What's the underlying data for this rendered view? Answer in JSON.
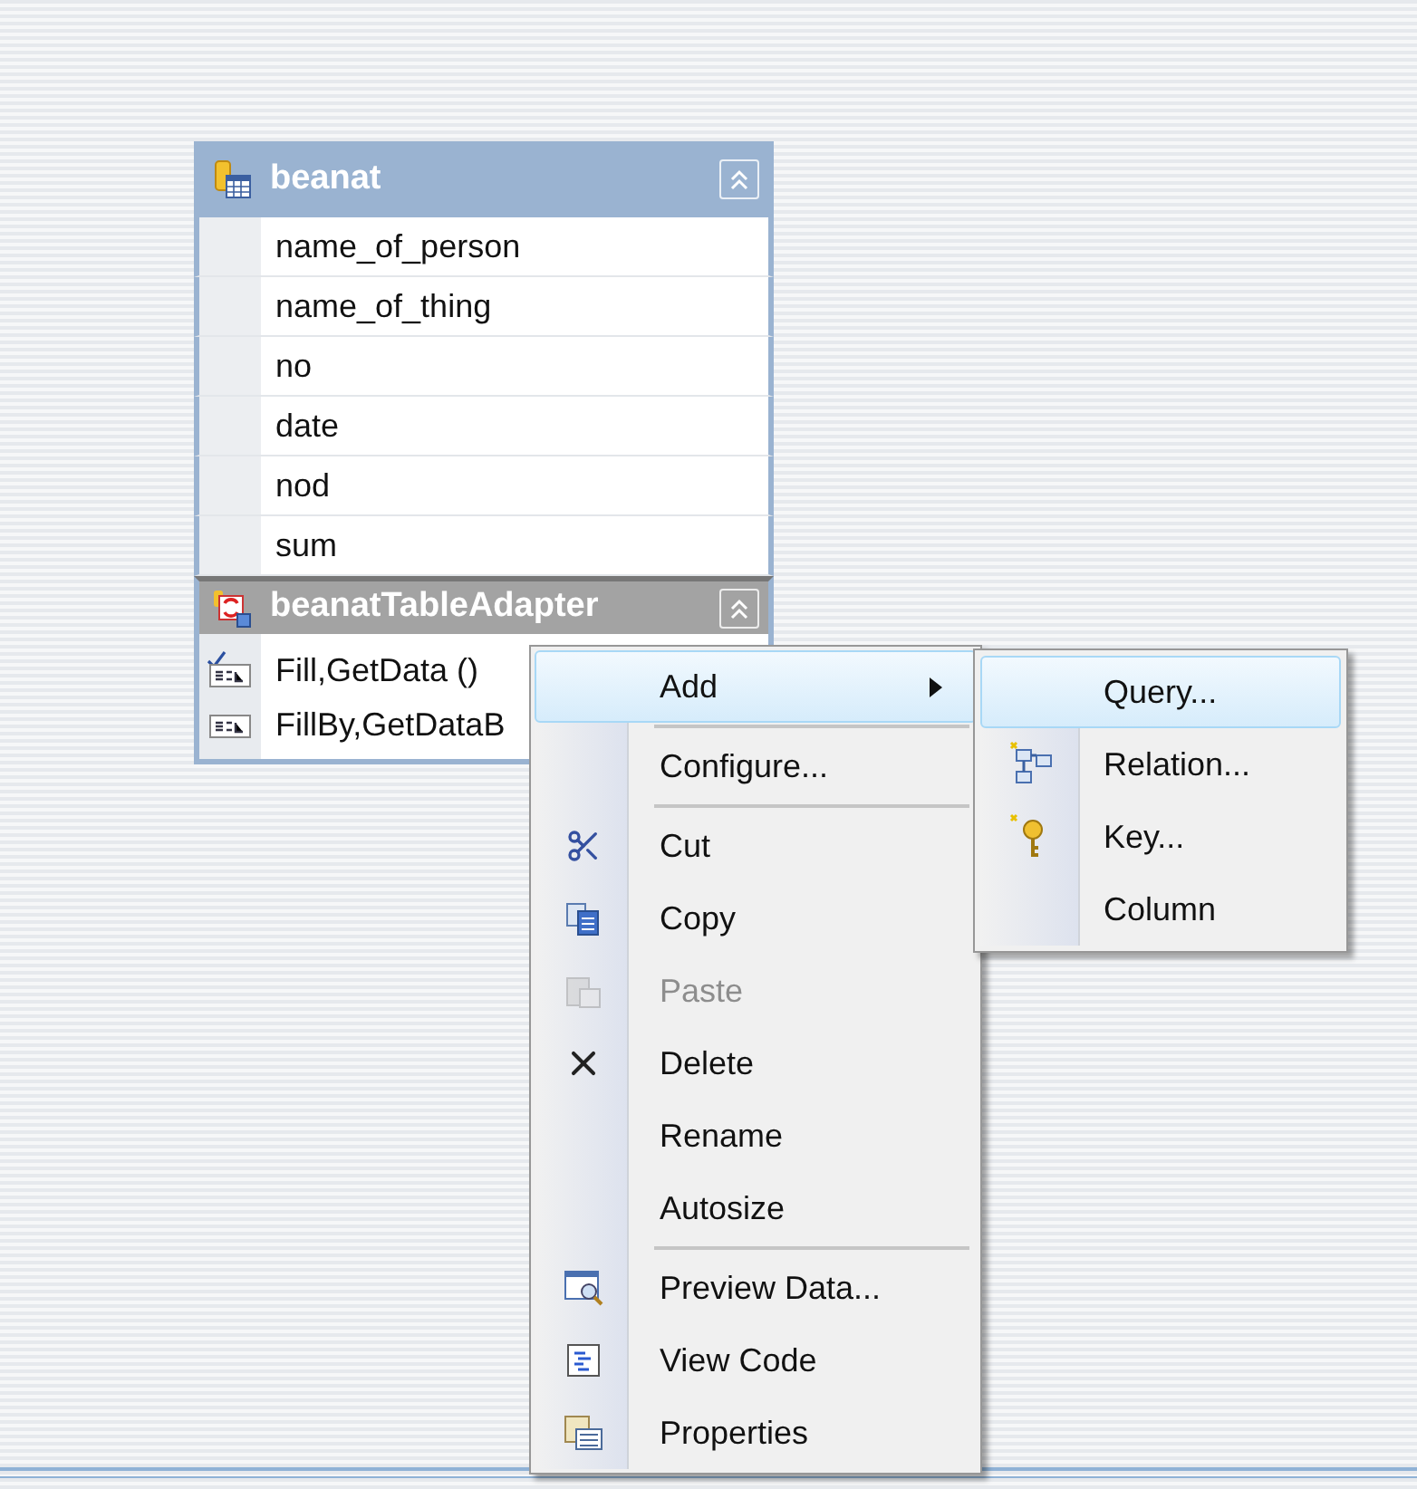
{
  "table": {
    "title": "beanat",
    "columns": [
      {
        "name": "name_of_person"
      },
      {
        "name": "name_of_thing"
      },
      {
        "name": "no"
      },
      {
        "name": "date"
      },
      {
        "name": "nod"
      },
      {
        "name": "sum"
      }
    ]
  },
  "adapter": {
    "title": "beanatTableAdapter",
    "methods": [
      {
        "label": "Fill,GetData ()",
        "checked": true
      },
      {
        "label": "FillBy,GetDataB",
        "checked": false
      }
    ]
  },
  "context_menu": {
    "items": [
      {
        "kind": "item",
        "label": "Add",
        "selected": true,
        "disabled": false,
        "has_submenu": true
      },
      {
        "kind": "separator"
      },
      {
        "kind": "item",
        "label": "Configure...",
        "selected": false,
        "disabled": false,
        "has_submenu": false
      },
      {
        "kind": "separator"
      },
      {
        "kind": "item",
        "label": "Cut",
        "selected": false,
        "disabled": false,
        "has_submenu": false
      },
      {
        "kind": "item",
        "label": "Copy",
        "selected": false,
        "disabled": false,
        "has_submenu": false
      },
      {
        "kind": "item",
        "label": "Paste",
        "selected": false,
        "disabled": true,
        "has_submenu": false
      },
      {
        "kind": "item",
        "label": "Delete",
        "selected": false,
        "disabled": false,
        "has_submenu": false
      },
      {
        "kind": "item",
        "label": "Rename",
        "selected": false,
        "disabled": false,
        "has_submenu": false
      },
      {
        "kind": "item",
        "label": "Autosize",
        "selected": false,
        "disabled": false,
        "has_submenu": false
      },
      {
        "kind": "separator"
      },
      {
        "kind": "item",
        "label": "Preview Data...",
        "selected": false,
        "disabled": false,
        "has_submenu": false
      },
      {
        "kind": "item",
        "label": "View Code",
        "selected": false,
        "disabled": false,
        "has_submenu": false
      },
      {
        "kind": "item",
        "label": "Properties",
        "selected": false,
        "disabled": false,
        "has_submenu": false
      }
    ]
  },
  "submenu": {
    "items": [
      {
        "label": "Query...",
        "selected": true
      },
      {
        "label": "Relation...",
        "selected": false
      },
      {
        "label": "Key...",
        "selected": false
      },
      {
        "label": "Column",
        "selected": false
      }
    ]
  }
}
